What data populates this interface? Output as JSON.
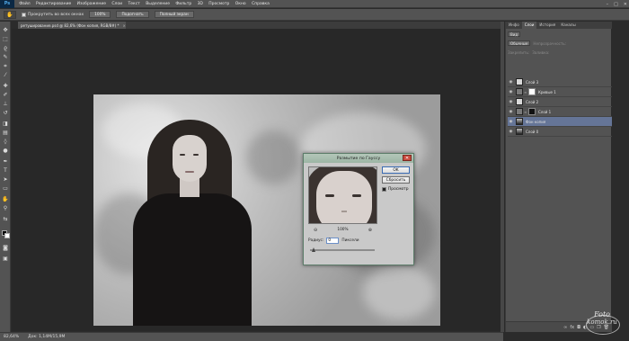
{
  "app": {
    "logo": "Ps",
    "menu": [
      "Файл",
      "Редактирование",
      "Изображение",
      "Слои",
      "Текст",
      "Выделение",
      "Фильтр",
      "3D",
      "Просмотр",
      "Окно",
      "Справка"
    ],
    "window_controls": [
      "–",
      "□",
      "✕"
    ]
  },
  "options_bar": {
    "tool_icon": "hand-icon",
    "scroll_all_label": "Прокрутить во всех окнах",
    "zoom_100": "100%",
    "fit_screen": "Подогнать",
    "fill_screen": "Полный экран"
  },
  "document": {
    "tab_title": "ретуширование.psd @ 82,6% (Фон копия, RGB/8#) *",
    "tab_close": "×"
  },
  "status": {
    "zoom": "82,64%",
    "doc_size": "Док: 1,14M/15,9M"
  },
  "dialog": {
    "title": "Размытие по Гауссу",
    "close": "✕",
    "ok": "OK",
    "reset": "Сбросить",
    "preview_label": "Просмотр",
    "preview_checked": true,
    "zoom_minus": "⊖",
    "zoom_plus": "⊕",
    "zoom_value": "100%",
    "radius_label": "Радиус:",
    "radius_value": "0",
    "radius_unit": "Пиксели"
  },
  "panel": {
    "tabs": [
      "Инфо",
      "Слои",
      "История",
      "Каналы"
    ],
    "active_tab": "Слои",
    "kind_label": "Вид",
    "blend_mode": "Обычные",
    "opacity_label": "Непрозрачность:",
    "lock_label": "Закрепить:",
    "fill_label": "Заливка:",
    "layers": [
      {
        "name": "Слой 3",
        "visible": true,
        "thumb": "light",
        "mask": false,
        "selected": false
      },
      {
        "name": "Кривые 1",
        "visible": true,
        "thumb": "adjust",
        "mask": "white",
        "selected": false
      },
      {
        "name": "Слой 2",
        "visible": true,
        "thumb": "light",
        "mask": false,
        "selected": false
      },
      {
        "name": "Слой 1",
        "visible": true,
        "thumb": "dark",
        "mask": "black",
        "selected": false
      },
      {
        "name": "Фон копия",
        "visible": true,
        "thumb": "portrait",
        "mask": false,
        "selected": true
      },
      {
        "name": "Слой 0",
        "visible": true,
        "thumb": "portrait",
        "mask": false,
        "selected": false
      }
    ],
    "footer_icons": [
      "link-icon",
      "fx-icon",
      "mask-icon",
      "adjustment-icon",
      "folder-icon",
      "new-layer-icon",
      "trash-icon"
    ]
  },
  "watermark": {
    "line1": "Foto",
    "line2": "komok.ru"
  },
  "colors": {
    "selected_layer": "#657597",
    "dialog_title": "#9db5a5",
    "close_button": "#c94a3f"
  }
}
